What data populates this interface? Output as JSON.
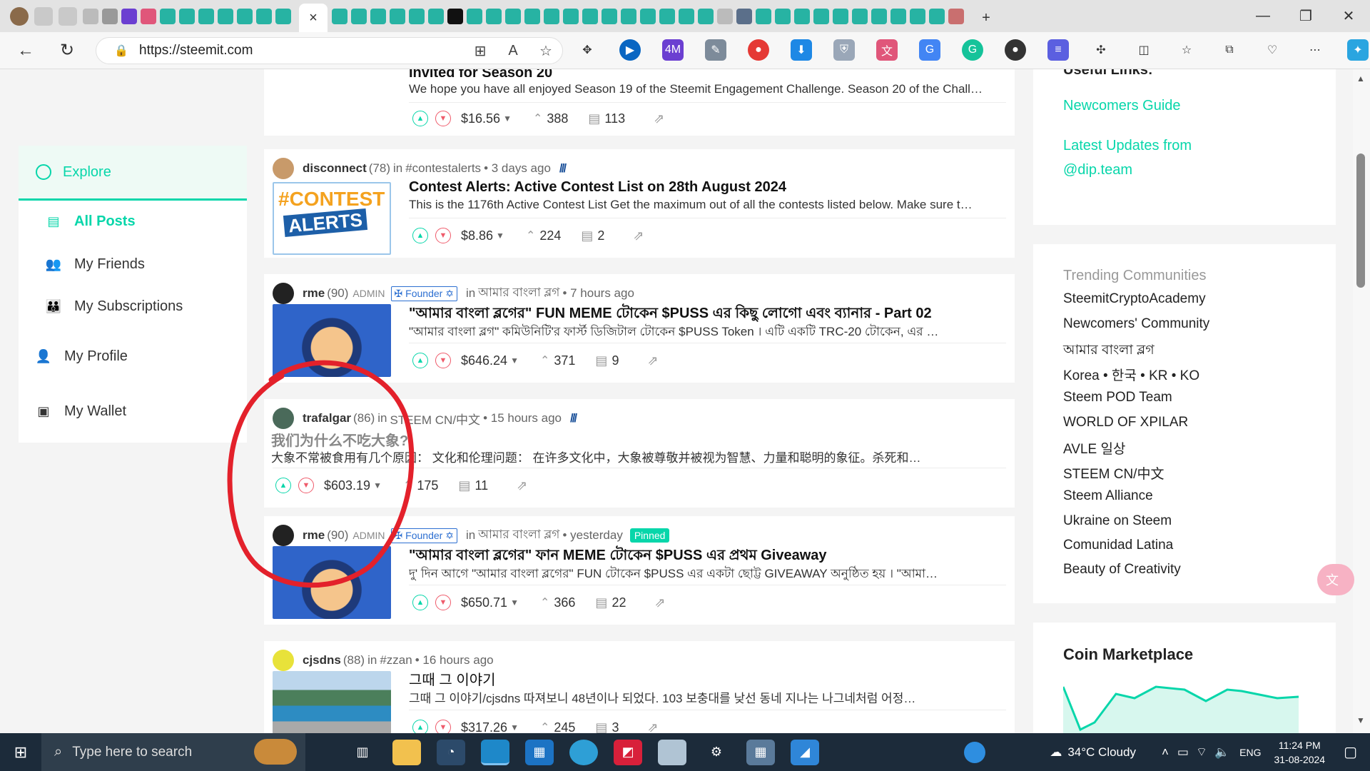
{
  "browser": {
    "url": "https://steemit.com",
    "active_tab_close": "×",
    "new_tab": "+",
    "win_controls": [
      "—",
      "❐",
      "✕"
    ]
  },
  "site": {
    "logo": "steemit"
  },
  "top_card": {
    "title": "Invited for Season 20",
    "excerpt": "We hope you have all enjoyed Season 19 of the Steemit Engagement Challenge. Season 20 of the Chall…",
    "payout": "$16.56",
    "votes": "388",
    "comments": "113"
  },
  "sidebar": {
    "explore": "Explore",
    "items": [
      {
        "label": "All Posts",
        "icon": "feed-icon"
      },
      {
        "label": "My Friends",
        "icon": "friends-icon"
      },
      {
        "label": "My Subscriptions",
        "icon": "subscriptions-icon"
      },
      {
        "label": "My Profile",
        "icon": "profile-icon"
      },
      {
        "label": "My Wallet",
        "icon": "wallet-icon"
      }
    ]
  },
  "posts": [
    {
      "author": "disconnect",
      "rep": "(78)",
      "in_text": "in",
      "community": "#contestalerts",
      "time": "• 3 days ago",
      "thumb_text_1": "#CONTEST",
      "thumb_text_2": "ALERTS",
      "title": "Contest Alerts: Active Contest List on 28th August 2024",
      "excerpt": "This is the 1176th Active Contest List Get the maximum out of all the contests listed below. Make sure t…",
      "payout": "$8.86",
      "votes": "224",
      "comments": "2"
    },
    {
      "author": "rme",
      "rep": "(90)",
      "role": "ADMIN",
      "badge": "✠ Founder ✡",
      "in_text": "in",
      "community": "আমার বাংলা ব্লগ",
      "time": "• 7 hours ago",
      "title": "\"আমার বাংলা ব্লগের\" FUN MEME টোকেন $PUSS এর কিছু লোগো এবং ব্যানার - Part 02",
      "excerpt": "\"আমার বাংলা ব্লগ\" কমিউনিটি'র ফার্স্ট ডিজিটাল টোকেন $PUSS Token । এটি একটি TRC-20 টোকেন, এর …",
      "payout": "$646.24",
      "votes": "371",
      "comments": "9"
    },
    {
      "author": "trafalgar",
      "rep": "(86)",
      "in_text": "in",
      "community": "STEEM CN/中文",
      "time": "• 15 hours ago",
      "title": "我们为什么不吃大象?",
      "excerpt": "大象不常被食用有几个原因： 文化和伦理问题： 在许多文化中，大象被尊敬并被视为智慧、力量和聪明的象征。杀死和…",
      "payout": "$603.19",
      "votes": "175",
      "comments": "11"
    },
    {
      "author": "rme",
      "rep": "(90)",
      "role": "ADMIN",
      "badge": "✠ Founder ✡",
      "in_text": "in",
      "community": "আমার বাংলা ব্লগ",
      "time": "• yesterday",
      "pinned": "Pinned",
      "title": "\"আমার বাংলা ব্লগের\" ফান MEME টোকেন $PUSS এর প্রথম Giveaway",
      "excerpt": "দু' দিন আগে \"আমার বাংলা ব্লগের\" FUN টোকেন $PUSS এর একটা ছোট্ট GIVEAWAY অনুষ্ঠিত হয় । \"আমা…",
      "payout": "$650.71",
      "votes": "366",
      "comments": "22"
    },
    {
      "author": "cjsdns",
      "rep": "(88)",
      "in_text": "in",
      "community": "#zzan",
      "time": "• 16 hours ago",
      "title": "그때 그 이야기",
      "excerpt": "그때 그 이야기/cjsdns 따져보니 48년이나 되었다. 103 보충대를 낮선 동네 지나는 나그네처럼 어정…",
      "payout": "$317.26",
      "votes": "245",
      "comments": "3"
    }
  ],
  "right": {
    "useful_title": "Useful Links:",
    "links": [
      "Newcomers Guide",
      "Latest Updates from",
      "@dip.team"
    ],
    "trending_title": "Trending Communities",
    "communities": [
      "SteemitCryptoAcademy",
      "Newcomers' Community",
      "আমার বাংলা ব্লগ",
      "Korea • 한국 • KR • KO",
      "Steem POD Team",
      "WORLD OF XPILAR",
      "AVLE 일상",
      "STEEM CN/中文",
      "Steem Alliance",
      "Ukraine on Steem",
      "Comunidad Latina",
      "Beauty of Creativity"
    ],
    "coin_title": "Coin Marketplace"
  },
  "taskbar": {
    "search_placeholder": "Type here to search",
    "weather": "34°C  Cloudy",
    "lang": "ENG",
    "time": "11:24 PM",
    "date": "31-08-2024"
  }
}
